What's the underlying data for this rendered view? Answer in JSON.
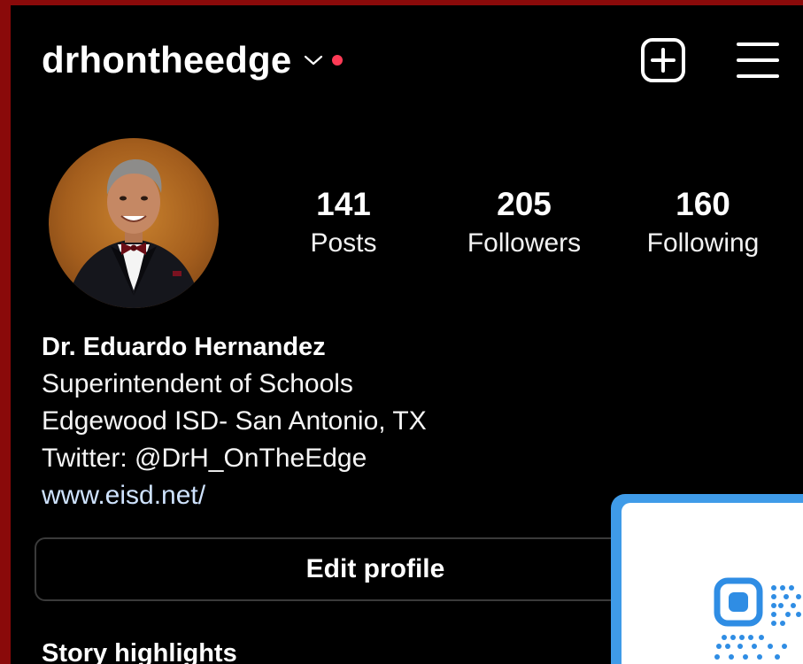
{
  "header": {
    "username": "drhontheedge",
    "notification_color": "#ff3b56",
    "icons": [
      "chevron-down-icon",
      "create-post-icon",
      "menu-icon"
    ]
  },
  "stats": [
    {
      "value": "141",
      "label": "Posts"
    },
    {
      "value": "205",
      "label": "Followers"
    },
    {
      "value": "160",
      "label": "Following"
    }
  ],
  "bio": {
    "name": "Dr. Eduardo Hernandez",
    "lines": [
      "Superintendent of Schools",
      "Edgewood ISD- San Antonio, TX",
      "Twitter: @DrH_OnTheEdge"
    ],
    "link": "www.eisd.net/"
  },
  "actions": {
    "edit_profile": "Edit profile"
  },
  "sections": {
    "story_highlights": "Story highlights"
  },
  "colors": {
    "frame": "#8a0a0a",
    "background": "#000000",
    "link": "#cfe3ff",
    "qr_card": "#3f9be8"
  }
}
